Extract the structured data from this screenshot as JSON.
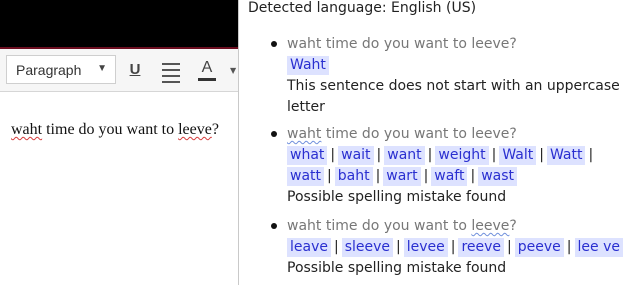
{
  "editor": {
    "format_select": "Paragraph",
    "content_before": "",
    "content_word1": "waht",
    "content_middle": " time do you want to ",
    "content_word2": "leeve",
    "content_after": "?"
  },
  "popup": {
    "detected_language": "Detected language: English (US)",
    "issues": [
      {
        "context_before": "waht time do you want to leeve?",
        "suggestions": [
          "Waht"
        ],
        "message": "This sentence does not start with an uppercase letter"
      },
      {
        "context_marked": "waht",
        "context_after": " time do you want to leeve?",
        "suggestions": [
          "what",
          "wait",
          "want",
          "weight",
          "Walt",
          "Watt",
          "watt",
          "baht",
          "wart",
          "waft",
          "wast"
        ],
        "message": "Possible spelling mistake found"
      },
      {
        "context_before": "waht time do you want to ",
        "context_marked": "leeve",
        "context_after": "?",
        "suggestions": [
          "leave",
          "sleeve",
          "levee",
          "reeve",
          "peeve",
          "lee ve"
        ],
        "message": "Possible spelling mistake found"
      }
    ]
  }
}
